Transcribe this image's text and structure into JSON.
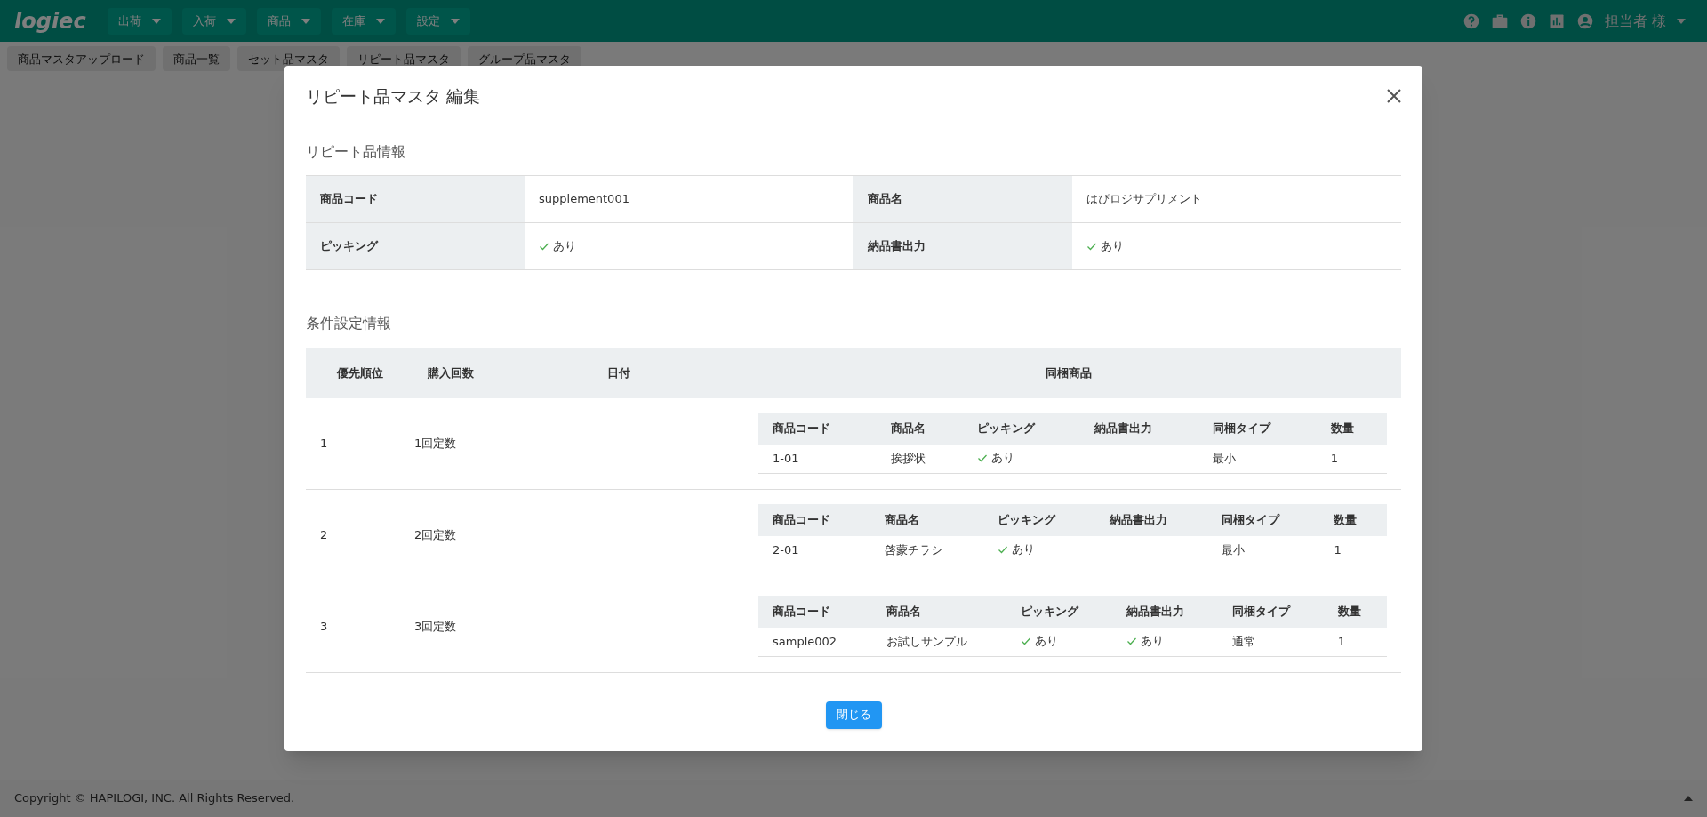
{
  "header": {
    "logo": "logiec",
    "menus": [
      {
        "label": "出荷"
      },
      {
        "label": "入荷"
      },
      {
        "label": "商品"
      },
      {
        "label": "在庫"
      },
      {
        "label": "設定"
      }
    ],
    "user": "担当者 様"
  },
  "subnav": [
    {
      "label": "商品マスタアップロード"
    },
    {
      "label": "商品一覧"
    },
    {
      "label": "セット品マスタ"
    },
    {
      "label": "リピート品マスタ"
    },
    {
      "label": "グループ品マスタ"
    }
  ],
  "footer": {
    "copyright": "Copyright © HAPILOGI, INC. All Rights Reserved."
  },
  "dialog": {
    "title": "リピート品マスタ 編集",
    "info_section": {
      "title": "リピート品情報",
      "rows": [
        [
          {
            "label": "商品コード",
            "value": {
              "text": "supplement001"
            }
          },
          {
            "label": "商品名",
            "value": {
              "text": "はぴロジサプリメント"
            }
          }
        ],
        [
          {
            "label": "ピッキング",
            "value": {
              "checked": true,
              "text": "あり"
            }
          },
          {
            "label": "納品書出力",
            "value": {
              "checked": true,
              "text": "あり"
            }
          }
        ]
      ]
    },
    "conditions_section": {
      "title": "条件設定情報",
      "columns": [
        "優先順位",
        "購入回数",
        "日付",
        "同梱商品"
      ],
      "rows": [
        {
          "priority": "1",
          "count": "1回定数",
          "sub_columns": [
            "商品コード",
            "商品名",
            "ピッキング",
            "納品書出力",
            "同梱タイプ",
            "数量"
          ],
          "items": [
            {
              "code": "1-01",
              "name": "挨拶状",
              "picking": {
                "checked": true,
                "text": "あり"
              },
              "invoice": {
                "checked": false
              },
              "type": "最小",
              "qty": "1"
            }
          ]
        },
        {
          "priority": "2",
          "count": "2回定数",
          "sub_columns": [
            "商品コード",
            "商品名",
            "ピッキング",
            "納品書出力",
            "同梱タイプ",
            "数量"
          ],
          "items": [
            {
              "code": "2-01",
              "name": "啓蒙チラシ",
              "picking": {
                "checked": true,
                "text": "あり"
              },
              "invoice": {
                "checked": false
              },
              "type": "最小",
              "qty": "1"
            }
          ]
        },
        {
          "priority": "3",
          "count": "3回定数",
          "sub_columns": [
            "商品コード",
            "商品名",
            "ピッキング",
            "納品書出力",
            "同梱タイプ",
            "数量"
          ],
          "items": [
            {
              "code": "sample002",
              "name": "お試しサンプル",
              "picking": {
                "checked": true,
                "text": "あり"
              },
              "invoice": {
                "checked": true,
                "text": "あり"
              },
              "type": "通常",
              "qty": "1"
            }
          ]
        }
      ]
    },
    "close_button": "閉じる"
  }
}
